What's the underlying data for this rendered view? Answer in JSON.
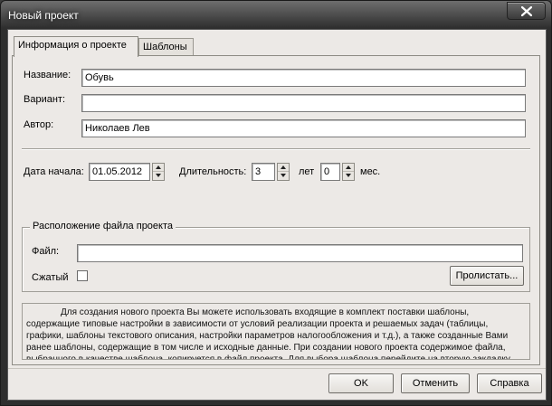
{
  "window": {
    "title": "Новый проект"
  },
  "tabs": [
    {
      "label": "Информация о проекте",
      "active": true
    },
    {
      "label": "Шаблоны",
      "active": false
    }
  ],
  "form": {
    "name_label": "Название:",
    "name_value": "Обувь",
    "variant_label": "Вариант:",
    "variant_value": "",
    "author_label": "Автор:",
    "author_value": "Николаев Лев",
    "start_label": "Дата начала:",
    "start_value": "01.05.2012",
    "duration_label": "Длительность:",
    "years_value": "3",
    "years_unit": "лет",
    "months_value": "0",
    "months_unit": "мес."
  },
  "file_group": {
    "title": "Расположение файла проекта",
    "file_label": "Файл:",
    "file_value": "",
    "compressed_label": "Сжатый",
    "compressed_checked": false,
    "browse_label": "Пролистать..."
  },
  "info_text": "Для создания нового проекта Вы можете использовать входящие в комплект поставки шаблоны, содержащие типовые настройки в зависимости от условий реализации проекта и решаемых задач (таблицы, графики, шаблоны текстового описания, настройки параметров налогообложения и т.д.), а также созданные Вами ранее шаблоны, содержащие в том числе и исходные данные. При создании нового проекта содержимое файла, выбранного в качестве шаблона, копируется в файл проекта. Для выбора шаблона перейдите на вторую закладку этого диалога.",
  "buttons": {
    "ok": "OK",
    "cancel": "Отменить",
    "help": "Справка"
  }
}
